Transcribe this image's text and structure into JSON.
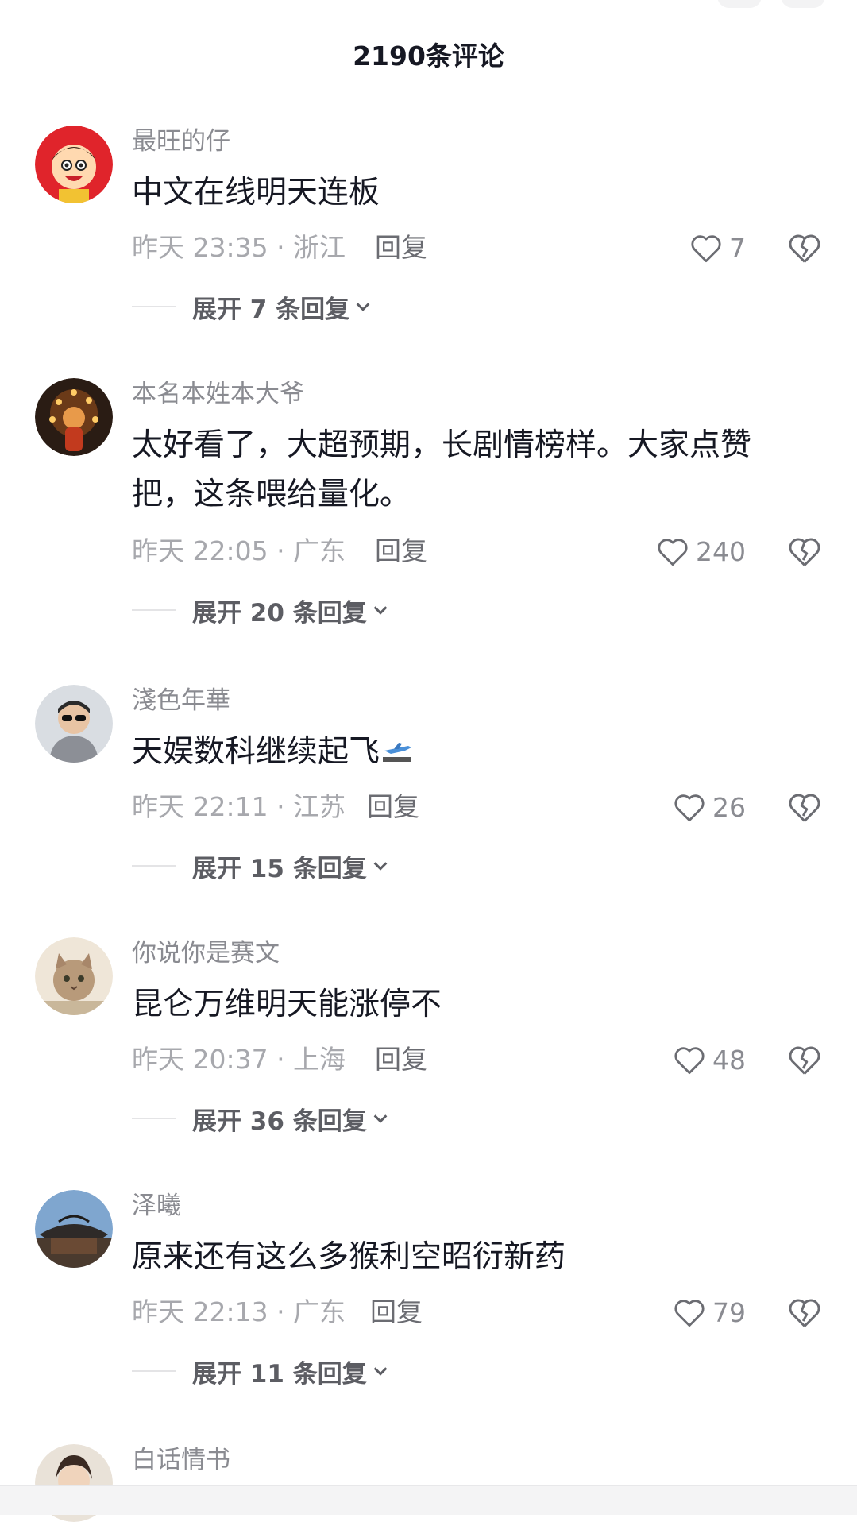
{
  "header": {
    "title": "2190条评论"
  },
  "comments": [
    {
      "username": "最旺的仔",
      "text": "中文在线明天连板",
      "time_location": "昨天 23:35 · 浙江",
      "reply_label": "回复",
      "likes": "7",
      "expand_label": "展开 7 条回复"
    },
    {
      "username": "本名本姓本大爷",
      "text": "太好看了，大超预期，长剧情榜样。大家点赞\n把，这条喂给量化。",
      "time_location": "昨天 22:05 · 广东",
      "reply_label": "回复",
      "likes": "240",
      "expand_label": "展开 20 条回复"
    },
    {
      "username": "淺色年華",
      "text": "天娱数科继续起飞",
      "time_location": "昨天 22:11 · 江苏",
      "reply_label": "回复",
      "likes": "26",
      "expand_label": "展开 15 条回复",
      "emoji": "airplane-icon"
    },
    {
      "username": "你说你是赛文",
      "text": "昆仑万维明天能涨停不",
      "time_location": "昨天 20:37 · 上海",
      "reply_label": "回复",
      "likes": "48",
      "expand_label": "展开 36 条回复"
    },
    {
      "username": "泽曦",
      "text": "原来还有这么多猴利空昭衍新药",
      "time_location": "昨天 22:13 · 广东",
      "reply_label": "回复",
      "likes": "79",
      "expand_label": "展开 11 条回复"
    },
    {
      "username": "白话情书"
    }
  ],
  "colors": {
    "text": "#161823",
    "secondary": "#8a8b91",
    "meta": "#a7a8ad",
    "accent_avatar": "#e0242b"
  }
}
